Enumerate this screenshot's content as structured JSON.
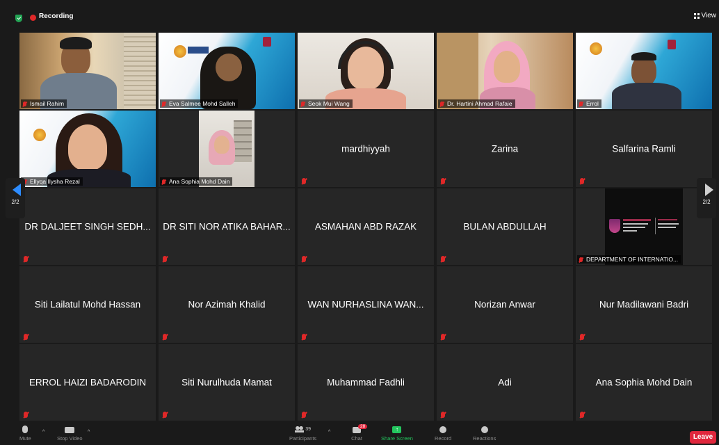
{
  "topbar": {
    "recording_label": "Recording",
    "view_label": "View"
  },
  "tiles": [
    {
      "name": "Ismail Rahim",
      "display": "video"
    },
    {
      "name": "Eva Salmee Mohd Salleh",
      "display": "video"
    },
    {
      "name": "Seok Mui Wang",
      "display": "video"
    },
    {
      "name": "Dr. Hartini Ahmad Rafaie",
      "display": "video"
    },
    {
      "name": "Errol",
      "display": "video"
    },
    {
      "name": "Ellyqa Ilysha Rezal",
      "display": "video"
    },
    {
      "name": "Ana Sophia Mohd Dain",
      "display": "video"
    },
    {
      "name": "mardhiyyah",
      "display": "name"
    },
    {
      "name": "Zarina",
      "display": "name"
    },
    {
      "name": "Salfarina Ramli",
      "display": "name"
    },
    {
      "name": "DR DALJEET SINGH SEDH...",
      "display": "name"
    },
    {
      "name": "DR SITI NOR ATIKA BAHAR...",
      "display": "name"
    },
    {
      "name": "ASMAHAN ABD RAZAK",
      "display": "name"
    },
    {
      "name": "BULAN ABDULLAH",
      "display": "name"
    },
    {
      "name": "DEPARTMENT OF INTERNATIO...",
      "display": "video"
    },
    {
      "name": "Siti Lailatul Mohd Hassan",
      "display": "name"
    },
    {
      "name": "Nor Azimah Khalid",
      "display": "name"
    },
    {
      "name": "WAN NURHASLINA WAN...",
      "display": "name"
    },
    {
      "name": "Norizan Anwar",
      "display": "name"
    },
    {
      "name": "Nur Madilawani Badri",
      "display": "name"
    },
    {
      "name": "ERROL HAIZI BADARODIN",
      "display": "name"
    },
    {
      "name": "Siti Nurulhuda Mamat",
      "display": "name"
    },
    {
      "name": "Muhammad Fadhli",
      "display": "name"
    },
    {
      "name": "Adi",
      "display": "name"
    },
    {
      "name": "Ana Sophia Mohd Dain",
      "display": "name"
    }
  ],
  "pager": {
    "left": "2/2",
    "right": "2/2"
  },
  "toolbar": {
    "mute": "Mute",
    "stop_video": "Stop Video",
    "participants": "Participants",
    "participants_count": "39",
    "chat": "Chat",
    "chat_badge": "28",
    "share_screen": "Share Screen",
    "record": "Record",
    "reactions": "Reactions",
    "leave": "Leave"
  },
  "colors": {
    "accent": "#2d8cff",
    "share": "#23c55e",
    "leave": "#e0273d",
    "muted": "#e02828"
  }
}
